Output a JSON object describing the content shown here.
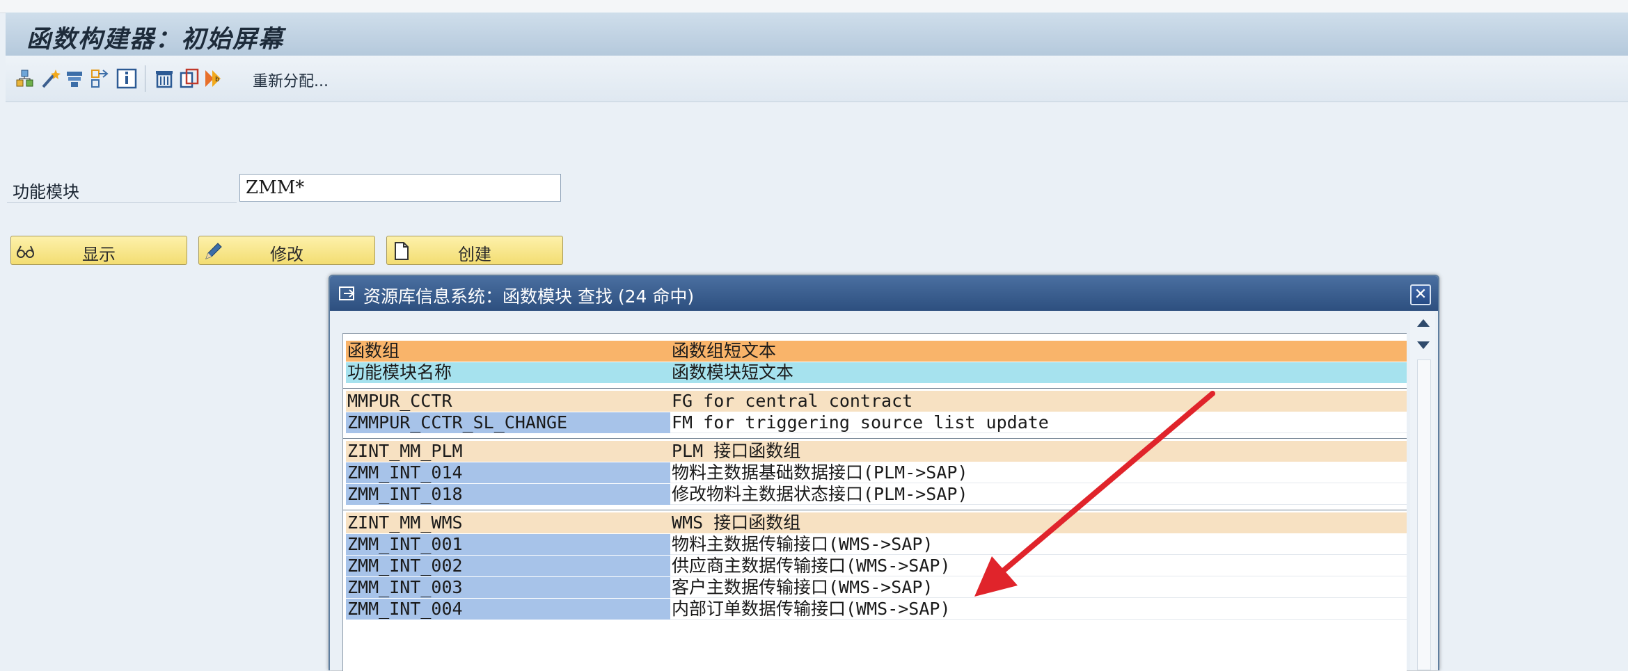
{
  "window": {
    "title": "函数构建器：初始屏幕"
  },
  "toolbar": {
    "icons": [
      "hierarchy-icon",
      "magic-wand-icon",
      "display-object-icon",
      "where-used-icon",
      "info-icon",
      "delete-icon",
      "copy-icon",
      "rename-icon"
    ],
    "reassign_label": "重新分配..."
  },
  "form": {
    "field_label": "功能模块",
    "field_value": "ZMM*",
    "buttons": {
      "display": "显示",
      "change": "修改",
      "create": "创建"
    }
  },
  "dialog": {
    "title": "资源库信息系统：函数模块 查找 (24 命中)",
    "close_label": "✕",
    "header": [
      {
        "col1": "函数组",
        "col2": "函数组短文本"
      },
      {
        "col1": "功能模块名称",
        "col2": "函数模块短文本"
      }
    ],
    "groups": [
      {
        "name": "MMPUR_CCTR",
        "text": "FG for central contract",
        "modules": [
          {
            "name": "ZMMPUR_CCTR_SL_CHANGE",
            "text": "FM for triggering source list update"
          }
        ]
      },
      {
        "name": "ZINT_MM_PLM",
        "text": "PLM 接口函数组",
        "modules": [
          {
            "name": "ZMM_INT_014",
            "text": "物料主数据基础数据接口(PLM->SAP)"
          },
          {
            "name": "ZMM_INT_018",
            "text": "修改物料主数据状态接口(PLM->SAP)"
          }
        ]
      },
      {
        "name": "ZINT_MM_WMS",
        "text": "WMS 接口函数组",
        "modules": [
          {
            "name": "ZMM_INT_001",
            "text": "物料主数据传输接口(WMS->SAP)"
          },
          {
            "name": "ZMM_INT_002",
            "text": "供应商主数据传输接口(WMS->SAP)"
          },
          {
            "name": "ZMM_INT_003",
            "text": "客户主数据传输接口(WMS->SAP)"
          },
          {
            "name": "ZMM_INT_004",
            "text": "内部订单数据传输接口(WMS->SAP)"
          }
        ]
      }
    ]
  },
  "colors": {
    "annotation_arrow": "#e0242b",
    "group_row": "#f7e1c2",
    "module_row": "#a7c3e9",
    "header1": "#f9b46a",
    "header2": "#a6e2ee"
  }
}
